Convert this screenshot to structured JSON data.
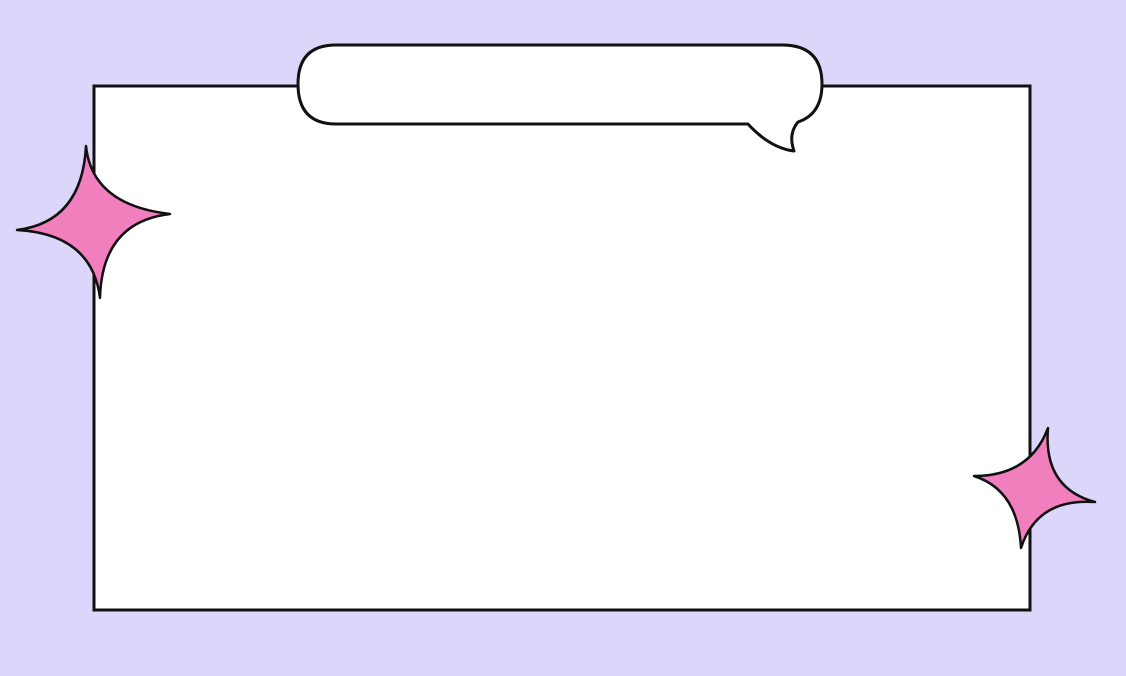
{
  "frame": {
    "speech_bubble_text": "",
    "card_text": ""
  },
  "colors": {
    "background": "#dcd6fb",
    "card_fill": "#ffffff",
    "outline": "#111111",
    "sparkle": "#f27fbd"
  },
  "icons": {
    "left_sparkle": "four-point-star",
    "right_sparkle": "four-point-star"
  }
}
